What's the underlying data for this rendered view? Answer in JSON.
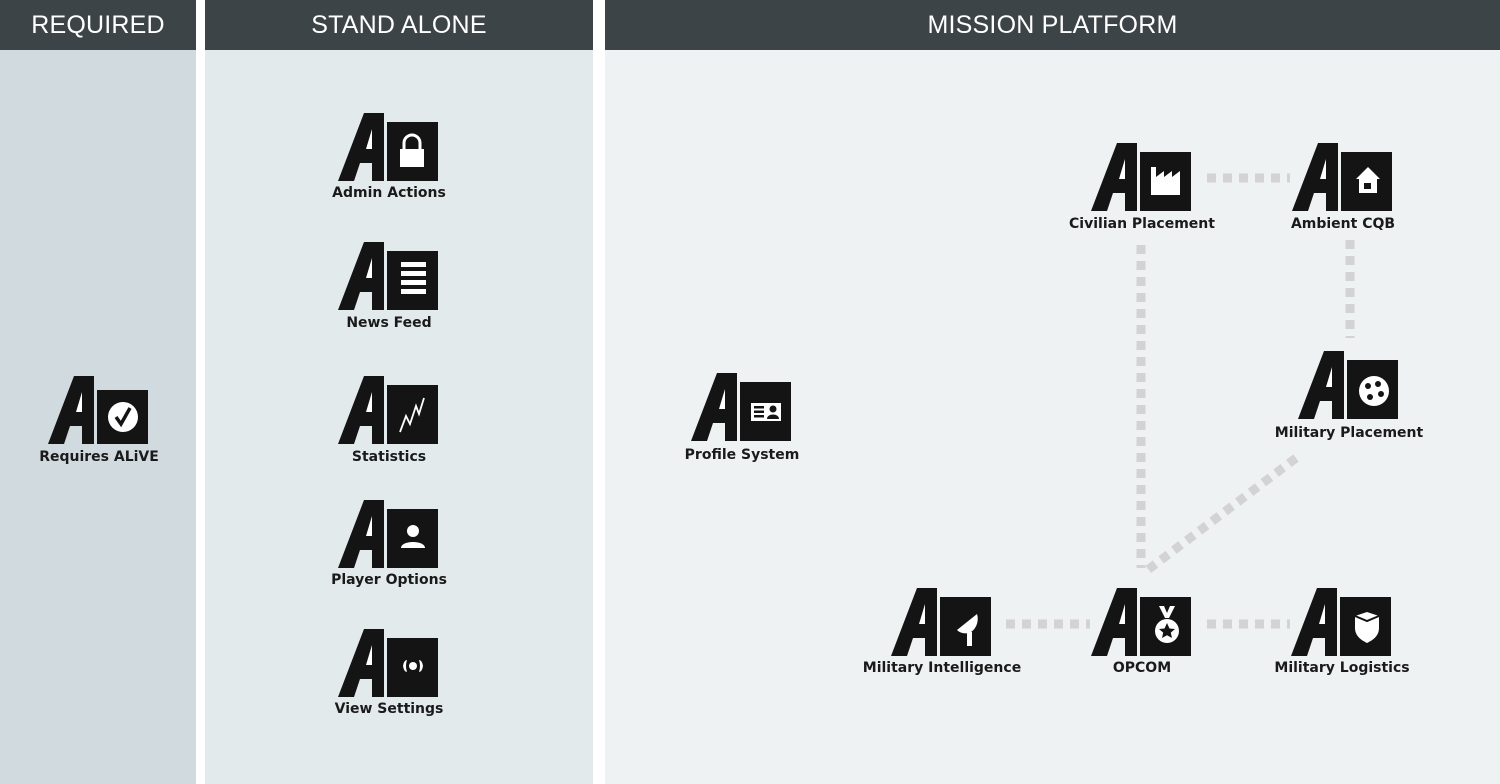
{
  "headers": {
    "required": "REQUIRED",
    "stand_alone": "STAND ALONE",
    "mission_platform": "MISSION PLATFORM"
  },
  "colors": {
    "header_bg": "#3d4447",
    "required_bg": "#d1dbdf",
    "stand_alone_bg": "#e3eaec",
    "mission_bg": "#eef2f2",
    "logo": "#141414",
    "connector": "#d3d3d3"
  },
  "modules": {
    "requires_alive": {
      "label": "Requires ALiVE",
      "icon": "checkmark-circle-icon"
    },
    "admin_actions": {
      "label": "Admin Actions",
      "icon": "padlock-icon"
    },
    "news_feed": {
      "label": "News Feed",
      "icon": "list-lines-icon"
    },
    "statistics": {
      "label": "Statistics",
      "icon": "zigzag-graph-icon"
    },
    "player_options": {
      "label": "Player Options",
      "icon": "user-icon"
    },
    "view_settings": {
      "label": "View Settings",
      "icon": "eye-icon"
    },
    "profile_system": {
      "label": "Profile System",
      "icon": "id-card-icon"
    },
    "civilian_placement": {
      "label": "Civilian Placement",
      "icon": "factory-icon"
    },
    "ambient_cqb": {
      "label": "Ambient CQB",
      "icon": "house-icon"
    },
    "military_placement": {
      "label": "Military Placement",
      "icon": "dots-circle-icon"
    },
    "military_intelligence": {
      "label": "Military Intelligence",
      "icon": "satellite-dish-icon"
    },
    "opcom": {
      "label": "OPCOM",
      "icon": "medal-star-icon"
    },
    "military_logistics": {
      "label": "Military Logistics",
      "icon": "shield-box-icon"
    }
  },
  "connections": [
    [
      "civilian_placement",
      "ambient_cqb"
    ],
    [
      "ambient_cqb",
      "military_placement"
    ],
    [
      "civilian_placement",
      "opcom"
    ],
    [
      "military_placement",
      "opcom"
    ],
    [
      "military_intelligence",
      "opcom"
    ],
    [
      "opcom",
      "military_logistics"
    ]
  ]
}
